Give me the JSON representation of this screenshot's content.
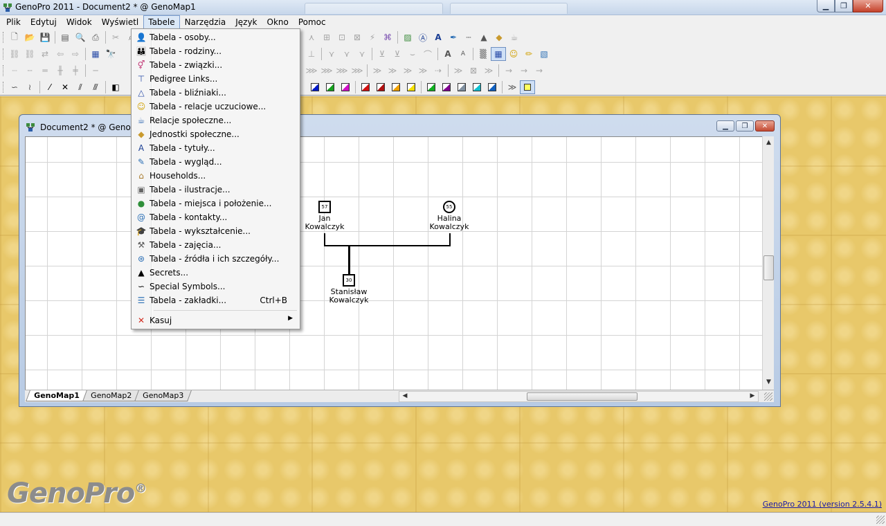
{
  "window": {
    "title": "GenoPro 2011 - Document2 * @ GenoMap1",
    "minimize": "▁",
    "restore": "❐",
    "close": "✕"
  },
  "menubar": [
    "Plik",
    "Edytuj",
    "Widok",
    "Wyświetl",
    "Tabele",
    "Narzędzia",
    "Język",
    "Okno",
    "Pomoc"
  ],
  "dropdown": {
    "items": [
      {
        "icon": "👤",
        "label": "Tabela - osoby...",
        "color": "#b8862b"
      },
      {
        "icon": "👪",
        "label": "Tabela - rodziny...",
        "color": "#b8862b"
      },
      {
        "icon": "⚥",
        "label": "Tabela - związki...",
        "color": "#c43d7a"
      },
      {
        "icon": "⊤",
        "label": "Pedigree Links...",
        "color": "#2b4da8"
      },
      {
        "icon": "△",
        "label": "Tabela - bliźniaki...",
        "color": "#2b4da8"
      },
      {
        "icon": "☺",
        "label": "Tabela - relacje uczuciowe...",
        "color": "#d1a000"
      },
      {
        "icon": "☕",
        "label": "Relacje społeczne...",
        "color": "#3a6fb5"
      },
      {
        "icon": "◆",
        "label": "Jednostki społeczne...",
        "color": "#c99a2e"
      },
      {
        "icon": "A",
        "label": "Tabela - tytuły...",
        "color": "#1c3f94"
      },
      {
        "icon": "✎",
        "label": "Tabela - wygląd...",
        "color": "#2b6fb5"
      },
      {
        "icon": "⌂",
        "label": "Households...",
        "color": "#a87a2b"
      },
      {
        "icon": "▣",
        "label": "Tabela - ilustracje...",
        "color": "#666666"
      },
      {
        "icon": "●",
        "label": "Tabela - miejsca i położenie...",
        "color": "#2f8f3a"
      },
      {
        "icon": "@",
        "label": "Tabela - kontakty...",
        "color": "#2b6fb5"
      },
      {
        "icon": "🎓",
        "label": "Tabela - wykształcenie...",
        "color": "#2b3f94"
      },
      {
        "icon": "⚒",
        "label": "Tabela - zajęcia...",
        "color": "#555555"
      },
      {
        "icon": "⊛",
        "label": "Tabela - źródła i ich szczegóły...",
        "color": "#2b6fb5"
      },
      {
        "icon": "▲",
        "label": "Secrets...",
        "color": "#000000"
      },
      {
        "icon": "∽",
        "label": "Special Symbols...",
        "color": "#000000"
      },
      {
        "icon": "☰",
        "label": "Tabela - zakładki...",
        "color": "#2b6fb5",
        "shortcut": "Ctrl+B"
      }
    ],
    "delete": {
      "icon": "✕",
      "label": "Kasuj",
      "color": "#d22b1f",
      "submenu": "▶"
    }
  },
  "child": {
    "title": "Document2 * @ GenoMa",
    "tabs": [
      "GenoMap1",
      "GenoMap2",
      "GenoMap3"
    ],
    "scroll_up": "▲",
    "scroll_down": "▼",
    "scroll_left": "◀",
    "scroll_right": "▶"
  },
  "people": {
    "jan": {
      "age": "57",
      "first": "Jan",
      "last": "Kowalczyk"
    },
    "halina": {
      "age": "55",
      "first": "Halina",
      "last": "Kowalczyk"
    },
    "stanislaw": {
      "age": "30",
      "first": "Stanisław",
      "last": "Kowalczyk"
    }
  },
  "branding": {
    "logo": "GenoPro",
    "registered": "®",
    "version": "GenoPro 2011 (version 2.5.4.1)"
  }
}
